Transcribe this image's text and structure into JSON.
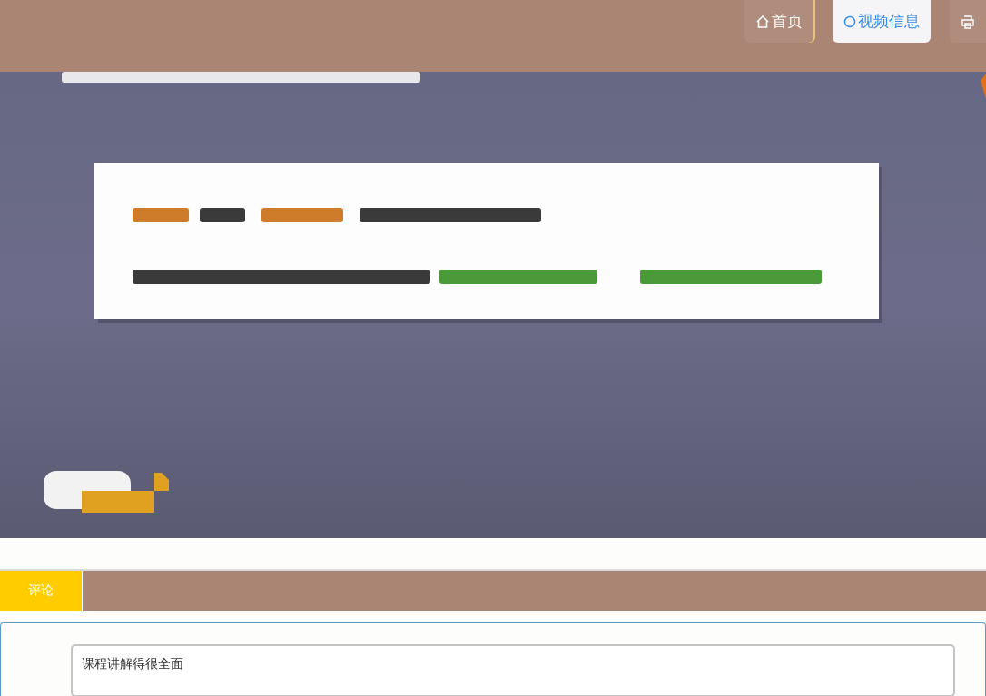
{
  "nav": [
    {
      "label": "首页",
      "kind": "home",
      "selected": false
    },
    {
      "label": "视频信息",
      "kind": "circle",
      "selected": true
    },
    {
      "kind": "printer",
      "selected": false
    }
  ],
  "tabs": [
    {
      "label": "评论",
      "selected": true
    }
  ],
  "comment": {
    "value": "课程讲解得很全面"
  }
}
